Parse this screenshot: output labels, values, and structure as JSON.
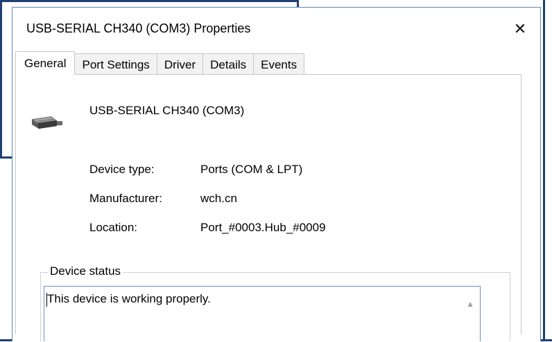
{
  "window": {
    "title": "USB-SERIAL CH340 (COM3) Properties",
    "close_glyph": "✕"
  },
  "tabs": [
    {
      "label": "General",
      "active": true
    },
    {
      "label": "Port Settings",
      "active": false
    },
    {
      "label": "Driver",
      "active": false
    },
    {
      "label": "Details",
      "active": false
    },
    {
      "label": "Events",
      "active": false
    }
  ],
  "device": {
    "icon": "serial-port-connector-icon",
    "name": "USB-SERIAL CH340 (COM3)"
  },
  "properties": [
    {
      "label": "Device type:",
      "value": "Ports (COM & LPT)"
    },
    {
      "label": "Manufacturer:",
      "value": "wch.cn"
    },
    {
      "label": "Location:",
      "value": "Port_#0003.Hub_#0009"
    }
  ],
  "status": {
    "group_label": "Device status",
    "text": "This device is working properly.",
    "scroll_up_glyph": "▲"
  },
  "colors": {
    "frame_blue": "#1f3f73",
    "dialog_border": "#5b86b8",
    "status_border": "#6f8fc4"
  }
}
